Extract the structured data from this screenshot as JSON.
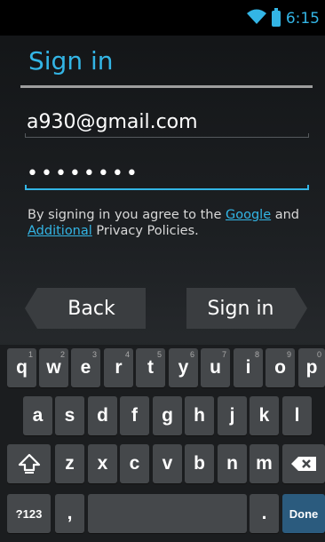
{
  "status_bar": {
    "time": "6:15"
  },
  "title": "Sign in",
  "email": {
    "value": "a930@gmail.com"
  },
  "password": {
    "value": "••••••••"
  },
  "policy": {
    "prefix": "By signing in you agree to the ",
    "link1": "Google",
    "middle": " and ",
    "link2": "Additional",
    "suffix": " Privacy Policies."
  },
  "buttons": {
    "back": "Back",
    "sign_in": "Sign in"
  },
  "keyboard": {
    "row1": [
      {
        "k": "q",
        "h": "1"
      },
      {
        "k": "w",
        "h": "2"
      },
      {
        "k": "e",
        "h": "3"
      },
      {
        "k": "r",
        "h": "4"
      },
      {
        "k": "t",
        "h": "5"
      },
      {
        "k": "y",
        "h": "6"
      },
      {
        "k": "u",
        "h": "7"
      },
      {
        "k": "i",
        "h": "8"
      },
      {
        "k": "o",
        "h": "9"
      },
      {
        "k": "p",
        "h": "0"
      }
    ],
    "row2": [
      "a",
      "s",
      "d",
      "f",
      "g",
      "h",
      "j",
      "k",
      "l"
    ],
    "row3": [
      "z",
      "x",
      "c",
      "v",
      "b",
      "n",
      "m"
    ],
    "symbols": "?123",
    "comma": ",",
    "period": ".",
    "done": "Done"
  },
  "colors": {
    "accent": "#33b5e5"
  }
}
